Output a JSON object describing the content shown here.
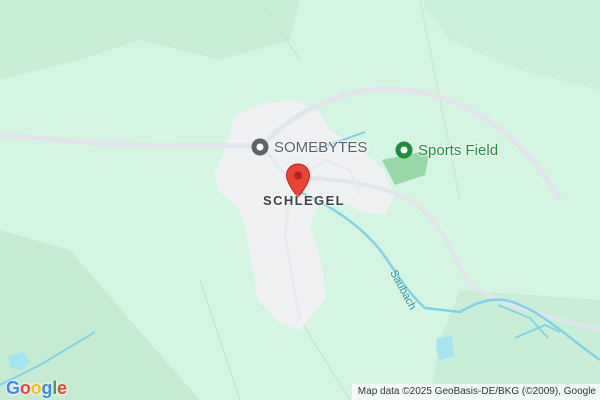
{
  "map": {
    "town_label": "SCHLEGEL",
    "river_label": "Saubach",
    "pois": [
      {
        "id": "somebytes",
        "label": "SOMEBYTES",
        "color": "#5f6368"
      },
      {
        "id": "sports-field",
        "label": "Sports Field",
        "color": "#1e8e3e"
      }
    ],
    "marker": {
      "color": "#ea4335",
      "icon": "map-pin-icon"
    }
  },
  "branding": {
    "logo_letters": [
      "G",
      "o",
      "o",
      "g",
      "l",
      "e"
    ],
    "logo_colors": [
      "#4285F4",
      "#EA4335",
      "#FBBC05",
      "#4285F4",
      "#34A853",
      "#EA4335"
    ]
  },
  "attribution": "Map data ©2025 GeoBasis-DE/BKG (©2009), Google",
  "colors": {
    "land": "#d5f5e3",
    "forest": "#c3ecd0",
    "road": "#e3e7ee",
    "water": "#7fd3e5",
    "builtup": "#f1f3f4"
  }
}
